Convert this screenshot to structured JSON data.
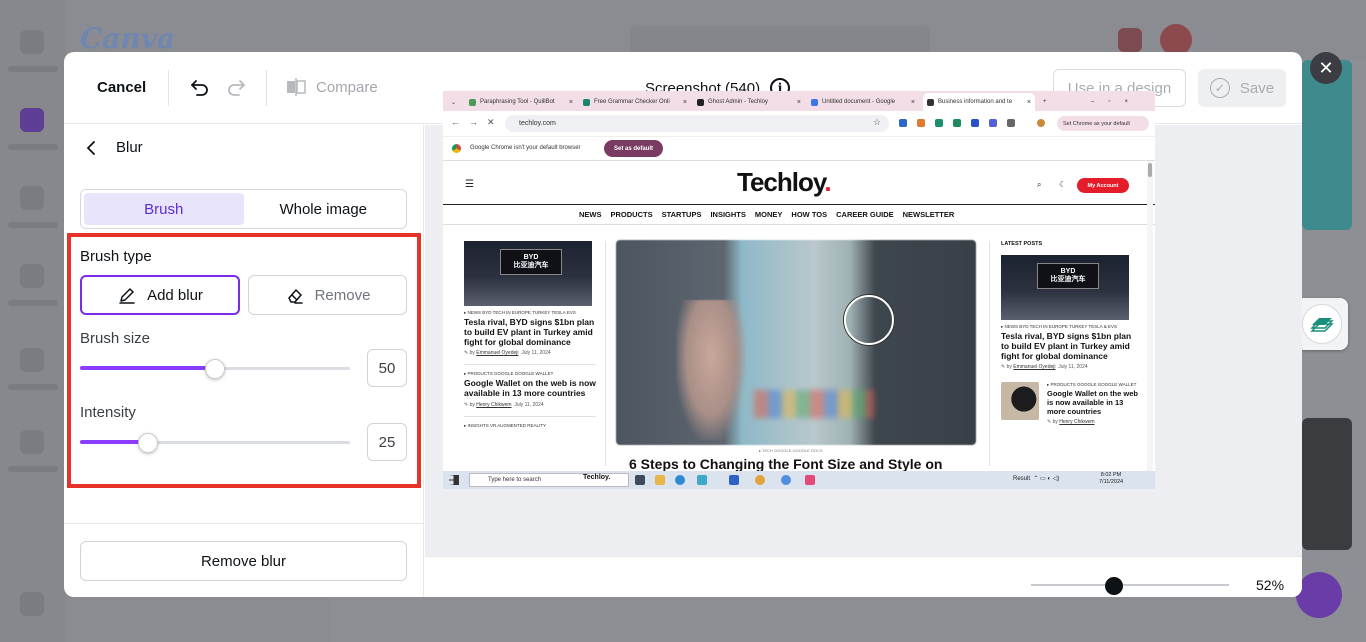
{
  "header": {
    "cancel_label": "Cancel",
    "compare_label": "Compare",
    "document_title": "Screenshot (540)",
    "use_in_design_label": "Use in a design",
    "save_label": "Save"
  },
  "panel": {
    "title": "Blur",
    "tabs": [
      {
        "label": "Brush",
        "active": true
      },
      {
        "label": "Whole image",
        "active": false
      }
    ],
    "brush_type_label": "Brush type",
    "add_blur_label": "Add blur",
    "remove_label": "Remove",
    "brush_size_label": "Brush size",
    "brush_size_value": "50",
    "brush_size_fraction": 0.5,
    "intensity_label": "Intensity",
    "intensity_value": "25",
    "intensity_fraction": 0.25,
    "remove_blur_label": "Remove blur"
  },
  "zoom": {
    "percent": "52%",
    "fraction": 0.42
  },
  "colors": {
    "accent": "#7d2ae8",
    "slider_fill": "#8b3dff",
    "highlight_box": "#e5332a",
    "active_tab_bg": "#e8e4fb",
    "site_red": "#e51d2b"
  },
  "screenshot": {
    "tabs": [
      "Paraphrasing Tool - QuillBot",
      "Free Grammar Checker Onli",
      "Ghost Admin - Techloy",
      "Untitled document - Google",
      "Business information and te"
    ],
    "url": "techloy.com",
    "set_default_url_label": "Set Chrome as your default",
    "infobar_message": "Google Chrome isn't your default browser",
    "set_default_button": "Set as default",
    "site_logo": "Techloy",
    "site_logo_dot": ".",
    "my_account": "My Account",
    "nav": [
      "NEWS",
      "PRODUCTS",
      "STARTUPS",
      "INSIGHTS",
      "MONEY",
      "HOW TOS",
      "CAREER GUIDE",
      "NEWSLETTER"
    ],
    "left_articles": [
      {
        "tags": "▸ NEWS BYD TECH IN EUROPE TURKEY TESLA EVS",
        "title": "Tesla rival, BYD signs $1bn plan to build EV plant in Turkey amid fight for global dominance",
        "author": "Emmanuel Oyedeji",
        "date": "July 11, 2024"
      },
      {
        "tags": "▸ PRODUCTS GOOGLE GOOGLE WALLET",
        "title": "Google Wallet on the web is now available in 13 more countries",
        "author": "Henry Chikwem",
        "date": "July 11, 2024"
      }
    ],
    "left_more_tags": "▸ INSIGHTS VR AUGMENTED REALITY",
    "byd_sign_top": "BYD",
    "byd_sign_bottom": "比亚迪汽车",
    "latest_posts_label": "LATEST POSTS",
    "right_articles": [
      {
        "tags": "▸ NEWS BYD TECH IN EUROPE TURKEY TESLA & EVS",
        "title": "Tesla rival, BYD signs $1bn plan to build EV plant in Turkey amid fight for global dominance",
        "author": "Emmanuel Oyedeji",
        "date": "July 11, 2024"
      },
      {
        "tags": "▸ PRODUCTS GOOGLE GOOGLE WALLET",
        "title": "Google Wallet on the web is now available in 13 more countries",
        "author": "Henry Chikwem",
        "date": ""
      }
    ],
    "feature_tag": "▸ TECH GOOGLE GOOGLE DOCS",
    "feature_title": "6 Steps to Changing the Font Size and Style on",
    "taskbar_search": "Type here to search",
    "taskbar_brand": "Techloy.",
    "taskbar_result": "Result",
    "clock_time": "8:02 PM",
    "clock_date": "7/11/2024"
  }
}
